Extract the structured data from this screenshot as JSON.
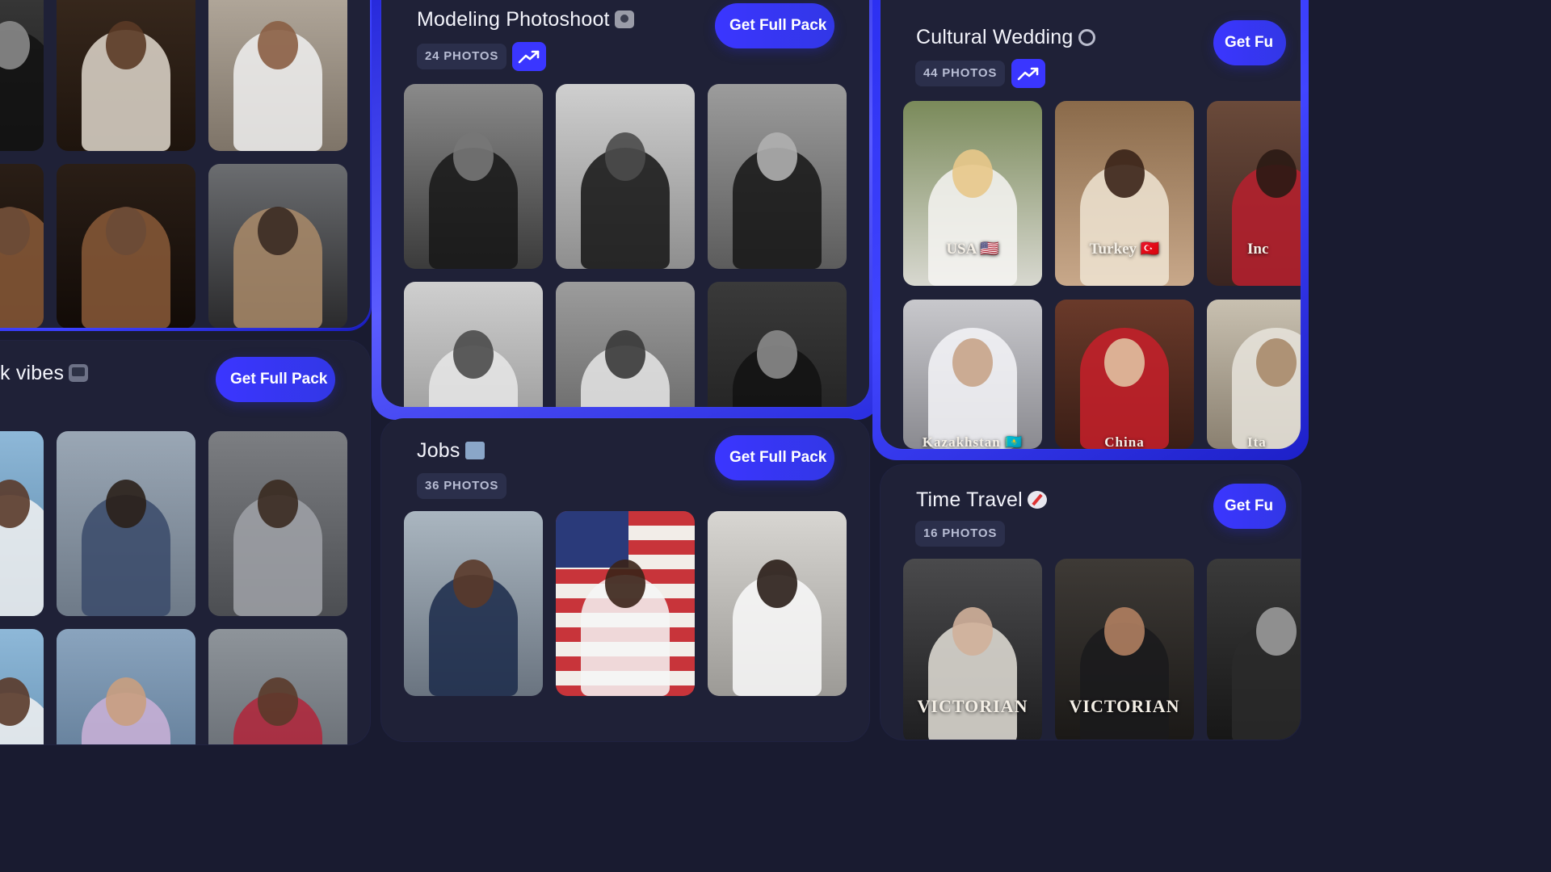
{
  "get_full_pack_label": "Get Full Pack",
  "cards": {
    "top_left": {},
    "street_vibes": {
      "title": "k vibes"
    },
    "modeling": {
      "title": "Modeling Photoshoot",
      "photos": "24 PHOTOS"
    },
    "jobs": {
      "title": "Jobs",
      "photos": "36 PHOTOS"
    },
    "wedding": {
      "title": "Cultural Wedding",
      "photos": "44 PHOTOS",
      "captions": [
        "USA 🇺🇸",
        "Turkey 🇹🇷",
        "Inc",
        "Kazakhstan 🇰🇿",
        "China",
        "Ita"
      ]
    },
    "time_travel": {
      "title": "Time Travel",
      "photos": "16 PHOTOS",
      "captions": [
        "VICTORIAN",
        "VICTORIAN"
      ]
    }
  },
  "button_partial": "Get Fu",
  "icons": {
    "trend": "trending-up-icon",
    "tv": "television-icon",
    "camera": "camera-flash-icon",
    "ring": "ring-icon",
    "shirt": "shirt-tie-icon",
    "compass": "compass-icon"
  },
  "colors": {
    "accent": "#3b36ff",
    "card_bg": "#1f2137",
    "page_bg": "#191b30"
  }
}
